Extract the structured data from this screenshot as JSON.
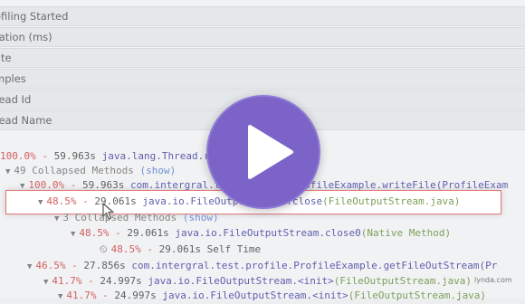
{
  "properties": [
    "ofiling Started",
    "ration (ms)",
    "ate",
    "mples",
    "read Id",
    "read Name"
  ],
  "tree": {
    "root": {
      "percent": "100.0%",
      "time": "59.963s",
      "method": "java.lang.Thread.run(Thread.java)"
    },
    "collapsed_1": {
      "label": "49 Collapsed Methods",
      "show": "(show)"
    },
    "write_file": {
      "percent": "100.0%",
      "time": "59.963s",
      "class": "com.intergral.test.profile.ProfileExample.",
      "method": "writeFile",
      "source": "(ProfileExam"
    },
    "close": {
      "percent": "48.5%",
      "time": "29.061s",
      "class": "java.io.FileOutputStream.",
      "method": "close",
      "source": "(FileOutputStream.java)"
    },
    "collapsed_2": {
      "label": "3 Collapsed Methods",
      "show": "(show)"
    },
    "close0": {
      "percent": "48.5%",
      "time": "29.061s",
      "class": "java.io.FileOutputStream.",
      "method": "close0",
      "source": "(Native Method)"
    },
    "self_time": {
      "percent": "48.5%",
      "time": "29.061s",
      "label": "Self Time"
    },
    "get_file_out": {
      "percent": "46.5%",
      "time": "27.856s",
      "class": "com.intergral.test.profile.ProfileExample.",
      "method": "getFileOutStream",
      "source": "(Pr"
    },
    "init_1": {
      "percent": "41.7%",
      "time": "24.997s",
      "class": "java.io.FileOutputStream.",
      "method": "<init>",
      "source": "(FileOutputStream.java)"
    },
    "init_2": {
      "percent": "41.7%",
      "time": "24.997s",
      "class": "java.io.FileOutputStream.",
      "method": "<init>",
      "source": "(FileOutputStream.java)"
    }
  },
  "watermark": "lynda.com",
  "icons": {
    "play": "play-icon",
    "cursor": "mouse-cursor-icon",
    "clock": "clock-icon"
  },
  "colors": {
    "play_button": "#7b63c7",
    "percent": "#c22222",
    "method": "#1e1e8c",
    "source": "#4a7a1a",
    "show_link": "#3a66c4"
  }
}
